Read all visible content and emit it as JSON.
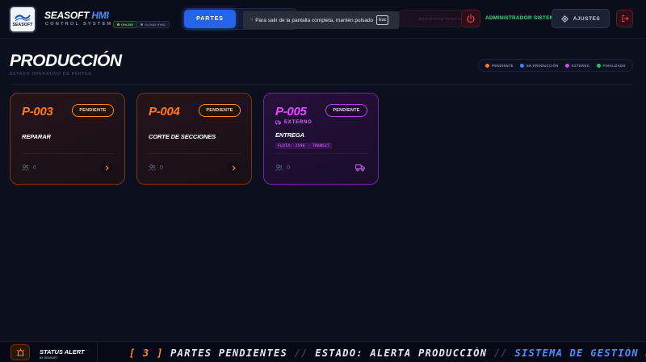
{
  "header": {
    "logo_text": "SEASOFT",
    "brand_main": "SEASOFT",
    "brand_accent": "HMI",
    "brand_sub": "CONTROL SYSTEM",
    "online_label": "ONLINE",
    "sync_label": "CLOUD SYNC",
    "tab_partes": "PARTES",
    "toast_text": "Para salir de la pantalla completa, mantén pulsado",
    "toast_key": "Esc",
    "register_label": "REGISTRAR PARA AVISO",
    "admin_label": "ADMINISTRADOR SISTEMA",
    "settings_label": "AJUSTES"
  },
  "page": {
    "title": "PRODUCCIÓN",
    "subtitle": "ESTADO OPERATIVO DE PARTES"
  },
  "legend": [
    {
      "label": "PENDIENTE",
      "color": "#ff7a1a"
    },
    {
      "label": "EN PRODUCCIÓN",
      "color": "#3b82f6"
    },
    {
      "label": "EXTERNO",
      "color": "#d946ef"
    },
    {
      "label": "FINALIZADO",
      "color": "#22c55e"
    }
  ],
  "cards": [
    {
      "id": "P-003",
      "status": "PENDIENTE",
      "task": "REPARAR",
      "people": "0",
      "variant": "orange"
    },
    {
      "id": "P-004",
      "status": "PENDIENTE",
      "task": "CORTE DE SECCIONES",
      "people": "0",
      "variant": "orange"
    },
    {
      "id": "P-005",
      "status": "PENDIENTE",
      "tag": "EXTERNO",
      "task": "ENTREGA",
      "flota": "FLOTA: 2598 - TRANSIT",
      "people": "0",
      "variant": "purple"
    }
  ],
  "footer": {
    "status_title": "STATUS ALERT",
    "status_by": "BY SEASOFT",
    "ticker": {
      "count": "[ 3 ]",
      "pending": "PARTES PENDIENTES",
      "sep1": "//",
      "state": "ESTADO: ALERTA PRODUCCIÓN",
      "sep2": "//",
      "system": "SISTEMA DE GESTIÓN D"
    }
  },
  "colors": {
    "accent_blue": "#2563eb",
    "online_green": "#3ddc84",
    "pending_orange": "#ff7a1a",
    "external_purple": "#e64cff"
  }
}
